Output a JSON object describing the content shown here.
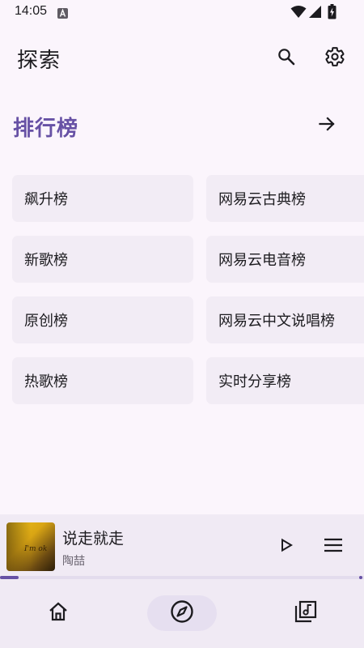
{
  "status_bar": {
    "time": "14:05",
    "icons": [
      "a-notification-icon",
      "wifi-icon",
      "signal-icon",
      "battery-charging-icon"
    ]
  },
  "app_bar": {
    "title": "探索",
    "actions": [
      "search-icon",
      "settings-icon"
    ]
  },
  "section": {
    "title": "排行榜",
    "action_icon": "arrow-right-icon"
  },
  "charts": [
    {
      "label": "飙升榜"
    },
    {
      "label": "网易云古典榜"
    },
    {
      "label": "新歌榜"
    },
    {
      "label": "网易云电音榜"
    },
    {
      "label": "原创榜"
    },
    {
      "label": "网易云中文说唱榜"
    },
    {
      "label": "热歌榜"
    },
    {
      "label": "实时分享榜"
    }
  ],
  "player": {
    "title": "说走就走",
    "artist": "陶喆",
    "album_art_text": "I'm ok",
    "progress": 0.05,
    "controls": [
      "play-icon",
      "queue-icon"
    ]
  },
  "bottom_nav": {
    "items": [
      "home-icon",
      "explore-icon",
      "library-icon"
    ],
    "selected": "explore-icon"
  },
  "colors": {
    "accent": "#6751a5",
    "background": "#fbf5fc",
    "card": "#f2ecf5",
    "nav_background": "#f0eaf4"
  }
}
